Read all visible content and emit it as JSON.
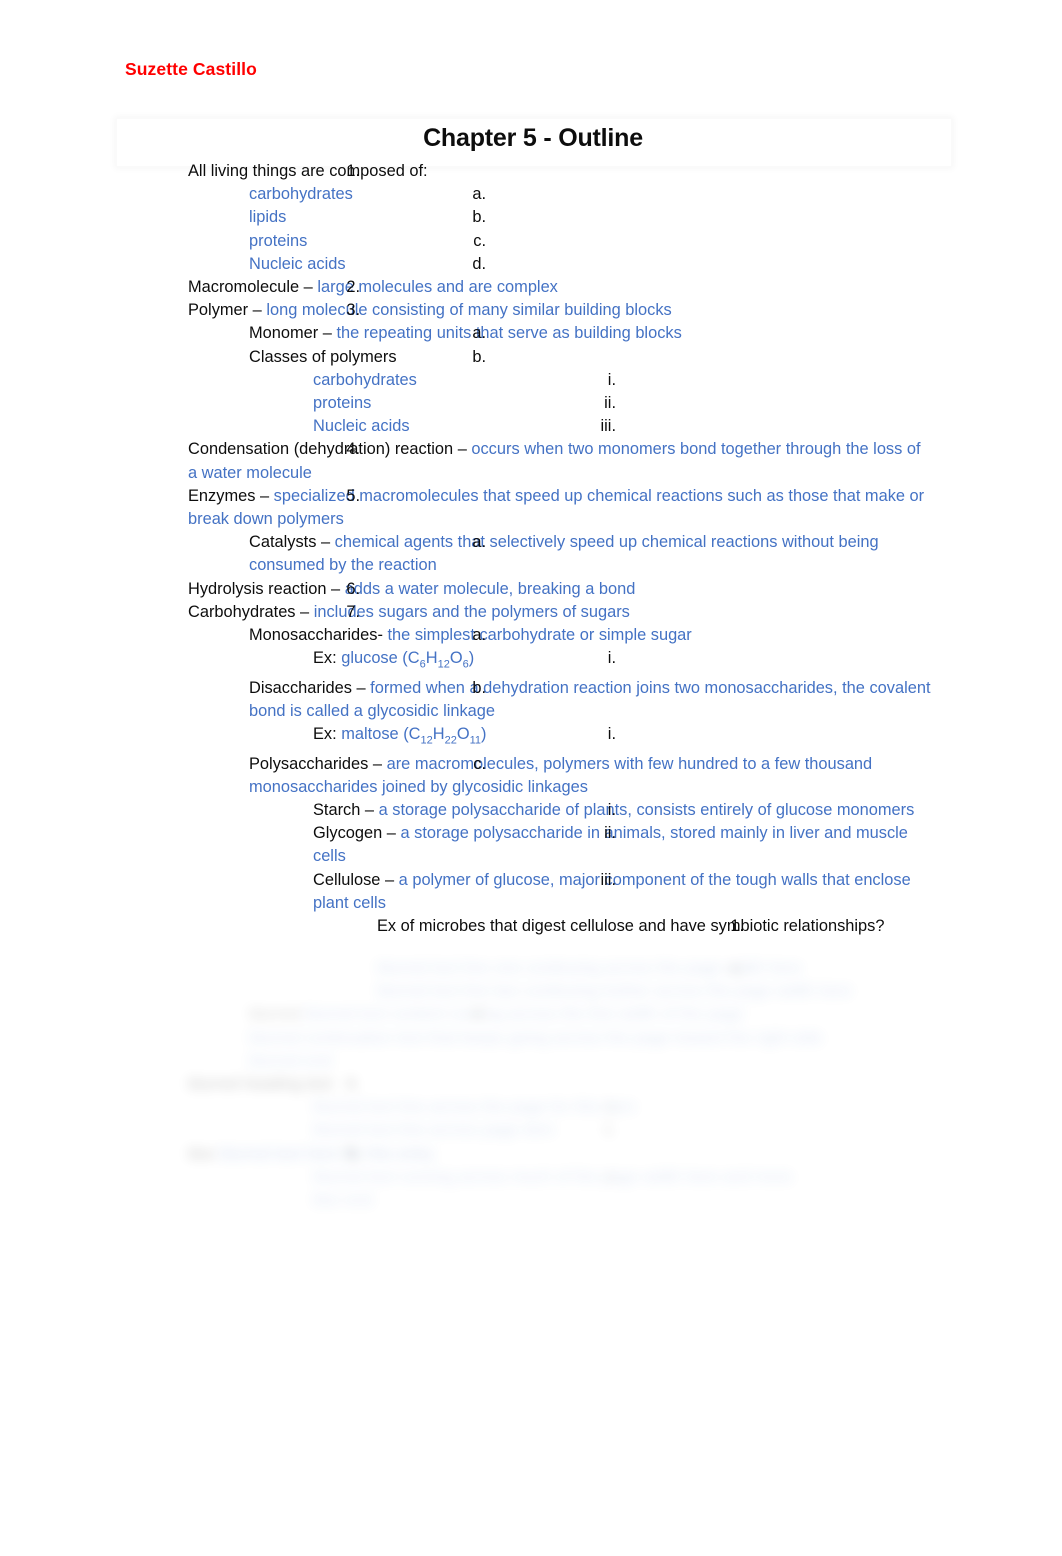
{
  "document": {
    "author": "Suzette Castillo",
    "title": "Chapter 5 - Outline"
  },
  "colors": {
    "author_red": "#ff0000",
    "body_black": "#0d0d0d",
    "accent_blue": "#4472c4",
    "page_background": "#ffffff"
  },
  "outline": [
    {
      "marker": "1.",
      "level": 1,
      "term": "All living things are composed of:",
      "definition": ""
    },
    {
      "marker": "a.",
      "level": 2,
      "term": "",
      "definition": "carbohydrates"
    },
    {
      "marker": "b.",
      "level": 2,
      "term": "",
      "definition": "lipids"
    },
    {
      "marker": "c.",
      "level": 2,
      "term": "",
      "definition": "proteins"
    },
    {
      "marker": "d.",
      "level": 2,
      "term": "",
      "definition": "Nucleic acids"
    },
    {
      "marker": "2.",
      "level": 1,
      "term": "Macromolecule – ",
      "definition": "large molecules and are complex"
    },
    {
      "marker": "3.",
      "level": 1,
      "term": "Polymer – ",
      "definition": "long molecule consisting of many similar building blocks"
    },
    {
      "marker": "a.",
      "level": 2,
      "term": "Monomer – ",
      "definition": "the repeating units that serve as building blocks"
    },
    {
      "marker": "b.",
      "level": 2,
      "term": "Classes of polymers",
      "definition": ""
    },
    {
      "marker": "i.",
      "level": 3,
      "term": "",
      "definition": "carbohydrates"
    },
    {
      "marker": "ii.",
      "level": 3,
      "term": "",
      "definition": "proteins"
    },
    {
      "marker": "iii.",
      "level": 3,
      "term": "",
      "definition": "Nucleic acids"
    },
    {
      "marker": "4.",
      "level": 1,
      "term": "Condensation (dehydration) reaction – ",
      "definition": "occurs when two monomers bond together through the loss of a water molecule"
    },
    {
      "marker": "5.",
      "level": 1,
      "term": "Enzymes – ",
      "definition": "specialized macromolecules that speed up chemical reactions such as those that make or break down polymers"
    },
    {
      "marker": "a.",
      "level": 2,
      "term": "Catalysts – ",
      "definition": "chemical agents that selectively speed up chemical reactions without being consumed by the reaction"
    },
    {
      "marker": "6.",
      "level": 1,
      "term": "Hydrolysis reaction – ",
      "definition": "adds a water molecule, breaking a bond"
    },
    {
      "marker": "7.",
      "level": 1,
      "term": "Carbohydrates – ",
      "definition": "includes sugars and the polymers of sugars"
    },
    {
      "marker": "a.",
      "level": 2,
      "term": "Monosaccharides- ",
      "definition": "the simplest carbohydrate or simple sugar"
    },
    {
      "marker": "i.",
      "level": 3,
      "term": "Ex: ",
      "definition": "glucose (C6H12O6)",
      "formula": {
        "name": "glucose",
        "parts": [
          "C",
          "6",
          "H",
          "12",
          "O",
          "6"
        ]
      }
    },
    {
      "marker": "b.",
      "level": 2,
      "term": "Disaccharides – ",
      "definition": "formed when a dehydration reaction joins two monosaccharides, the covalent bond is called a glycosidic linkage"
    },
    {
      "marker": "i.",
      "level": 3,
      "term": "Ex: ",
      "definition": "maltose (C12H22O11)",
      "formula": {
        "name": "maltose",
        "parts": [
          "C",
          "12",
          "H",
          "22",
          "O",
          "11"
        ]
      }
    },
    {
      "marker": "c.",
      "level": 2,
      "term": "Polysaccharides – ",
      "definition": "are macromolecules, polymers with few hundred to a few thousand monosaccharides joined by glycosidic linkages"
    },
    {
      "marker": "i.",
      "level": 3,
      "term": "Starch – ",
      "definition": "a storage polysaccharide of plants, consists entirely of glucose monomers"
    },
    {
      "marker": "ii.",
      "level": 3,
      "term": "Glycogen – ",
      "definition": "a storage polysaccharide in animals, stored mainly in liver and muscle cells"
    },
    {
      "marker": "iii.",
      "level": 3,
      "term": "Cellulose – ",
      "definition": "a polymer of glucose, major component of the tough walls that enclose plant cells"
    },
    {
      "marker": "1.",
      "level": 4,
      "term": "Ex of microbes that digest cellulose and have symbiotic relationships?",
      "definition": ""
    }
  ],
  "obscured_section": {
    "note": "blurred illegible text",
    "rows": [
      {
        "marker": "a.",
        "level": 4,
        "term": "",
        "definition": "blurred text line one continuing across the page width here"
      },
      {
        "marker": "",
        "level": 4,
        "term": "",
        "definition": "blurred text line two continuing further across the page width here"
      },
      {
        "marker": "d.",
        "level": 2,
        "term": "blurred ",
        "definition": "blurred text content running across the line width of the page"
      },
      {
        "marker": "",
        "level": 2,
        "term": "",
        "definition": "blurred continuation text that keeps going across the page toward the right side"
      },
      {
        "marker": "",
        "level": 2,
        "term": "",
        "definition": "blurred end"
      },
      {
        "marker": "8.",
        "level": 1,
        "term": "blurred heading text",
        "definition": ""
      },
      {
        "marker": "i.",
        "level": 3,
        "term": "",
        "definition": "blurred text line across the page for this item"
      },
      {
        "marker": "ii.",
        "level": 3,
        "term": "",
        "definition": "blurred text line across page item"
      },
      {
        "marker": "9.",
        "level": 1,
        "term": "blur ",
        "definition": "blurred text here for this entry"
      },
      {
        "marker": "i.",
        "level": 3,
        "term": "",
        "definition": "blurred text running across much of the page width here and more"
      },
      {
        "marker": "",
        "level": 3,
        "term": "",
        "definition": "blur end"
      }
    ]
  }
}
